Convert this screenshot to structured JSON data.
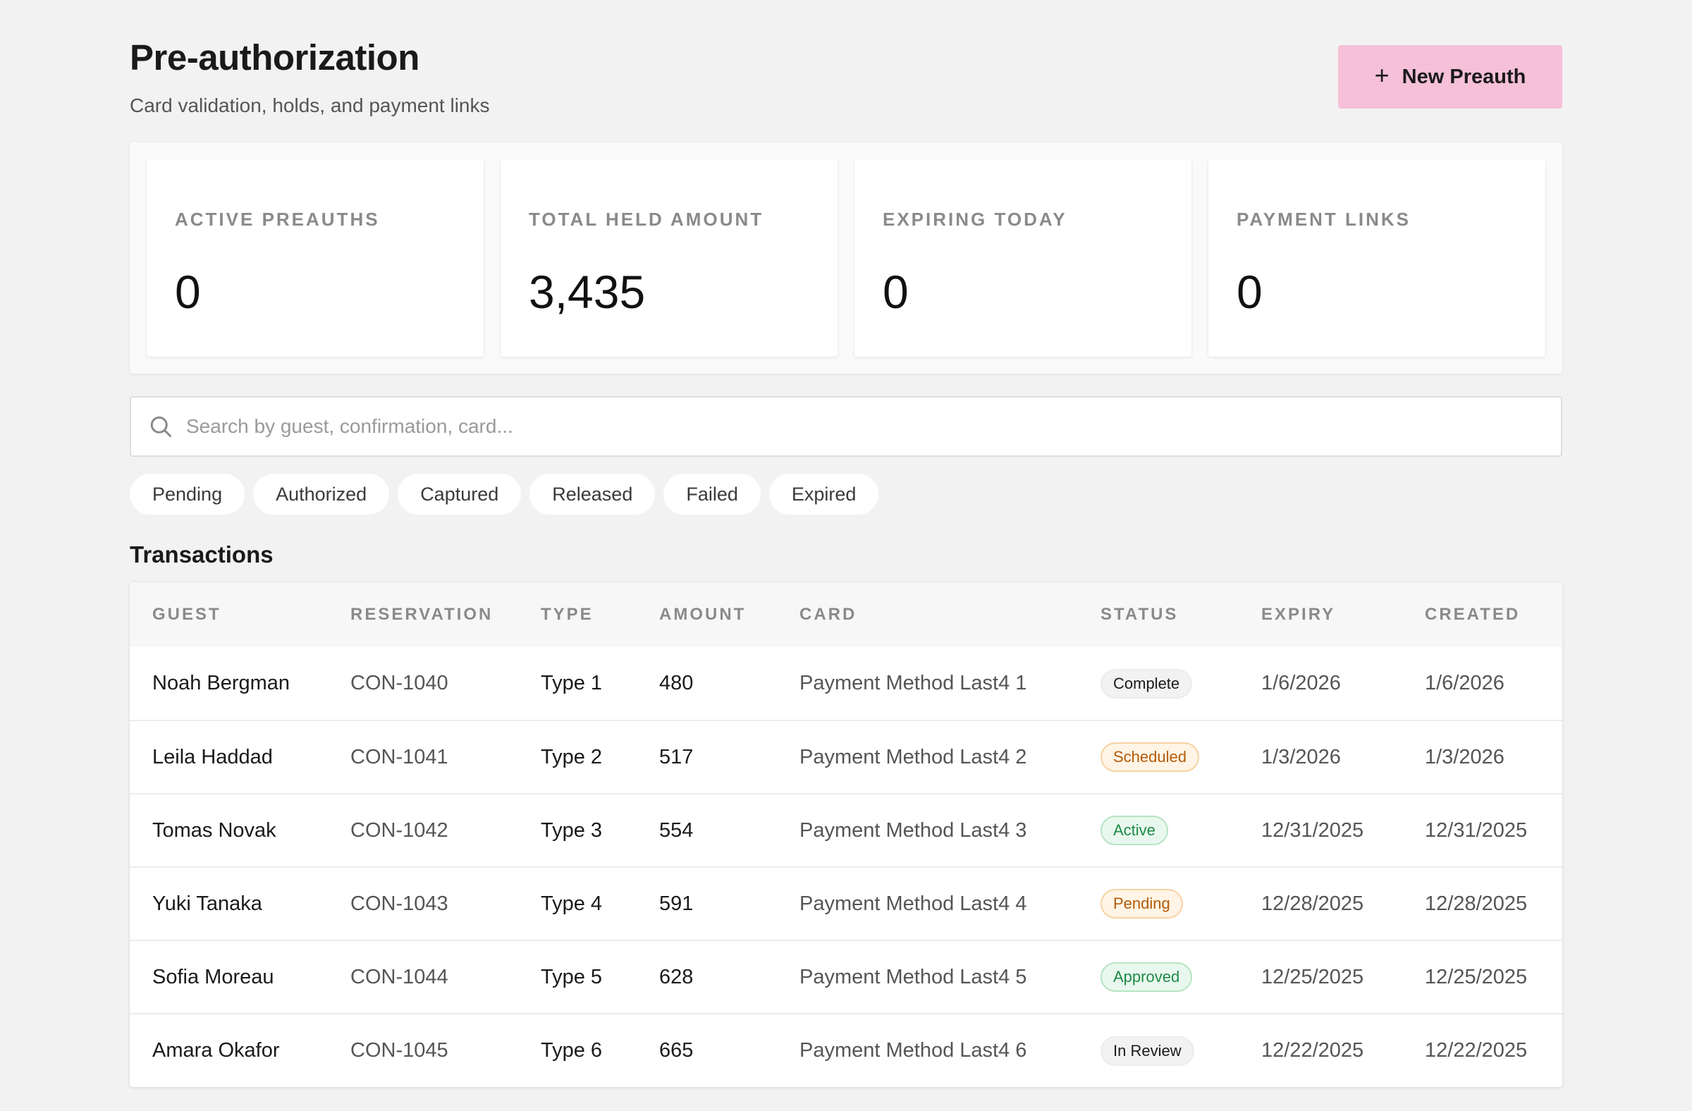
{
  "header": {
    "title": "Pre-authorization",
    "subtitle": "Card validation, holds, and payment links",
    "new_button_icon": "plus-icon",
    "new_button_label": "New Preauth"
  },
  "stats": [
    {
      "label": "ACTIVE PREAUTHS",
      "value": "0"
    },
    {
      "label": "TOTAL HELD AMOUNT",
      "value": "3,435"
    },
    {
      "label": "EXPIRING TODAY",
      "value": "0"
    },
    {
      "label": "PAYMENT LINKS",
      "value": "0"
    }
  ],
  "search": {
    "icon": "search-icon",
    "placeholder": "Search by guest, confirmation, card...",
    "value": ""
  },
  "filters": [
    "Pending",
    "Authorized",
    "Captured",
    "Released",
    "Failed",
    "Expired"
  ],
  "transactions": {
    "title": "Transactions",
    "columns": [
      "GUEST",
      "RESERVATION",
      "TYPE",
      "AMOUNT",
      "CARD",
      "STATUS",
      "EXPIRY",
      "CREATED"
    ],
    "rows": [
      {
        "guest": "Noah Bergman",
        "reservation": "CON-1040",
        "type": "Type 1",
        "amount": "480",
        "card": "Payment Method Last4 1",
        "status": "Complete",
        "status_kind": "neutral",
        "expiry": "1/6/2026",
        "created": "1/6/2026"
      },
      {
        "guest": "Leila Haddad",
        "reservation": "CON-1041",
        "type": "Type 2",
        "amount": "517",
        "card": "Payment Method Last4 2",
        "status": "Scheduled",
        "status_kind": "warn",
        "expiry": "1/3/2026",
        "created": "1/3/2026"
      },
      {
        "guest": "Tomas Novak",
        "reservation": "CON-1042",
        "type": "Type 3",
        "amount": "554",
        "card": "Payment Method Last4 3",
        "status": "Active",
        "status_kind": "ok",
        "expiry": "12/31/2025",
        "created": "12/31/2025"
      },
      {
        "guest": "Yuki Tanaka",
        "reservation": "CON-1043",
        "type": "Type 4",
        "amount": "591",
        "card": "Payment Method Last4 4",
        "status": "Pending",
        "status_kind": "warn",
        "expiry": "12/28/2025",
        "created": "12/28/2025"
      },
      {
        "guest": "Sofia Moreau",
        "reservation": "CON-1044",
        "type": "Type 5",
        "amount": "628",
        "card": "Payment Method Last4 5",
        "status": "Approved",
        "status_kind": "ok",
        "expiry": "12/25/2025",
        "created": "12/25/2025"
      },
      {
        "guest": "Amara Okafor",
        "reservation": "CON-1045",
        "type": "Type 6",
        "amount": "665",
        "card": "Payment Method Last4 6",
        "status": "In Review",
        "status_kind": "neutral",
        "expiry": "12/22/2025",
        "created": "12/22/2025"
      }
    ]
  },
  "colors": {
    "background": "#f2f2f2",
    "primary_button": "#f5c0d8",
    "status_neutral": "#f2f2f2",
    "status_warn": "#b45a07",
    "status_ok": "#1d8a46"
  }
}
